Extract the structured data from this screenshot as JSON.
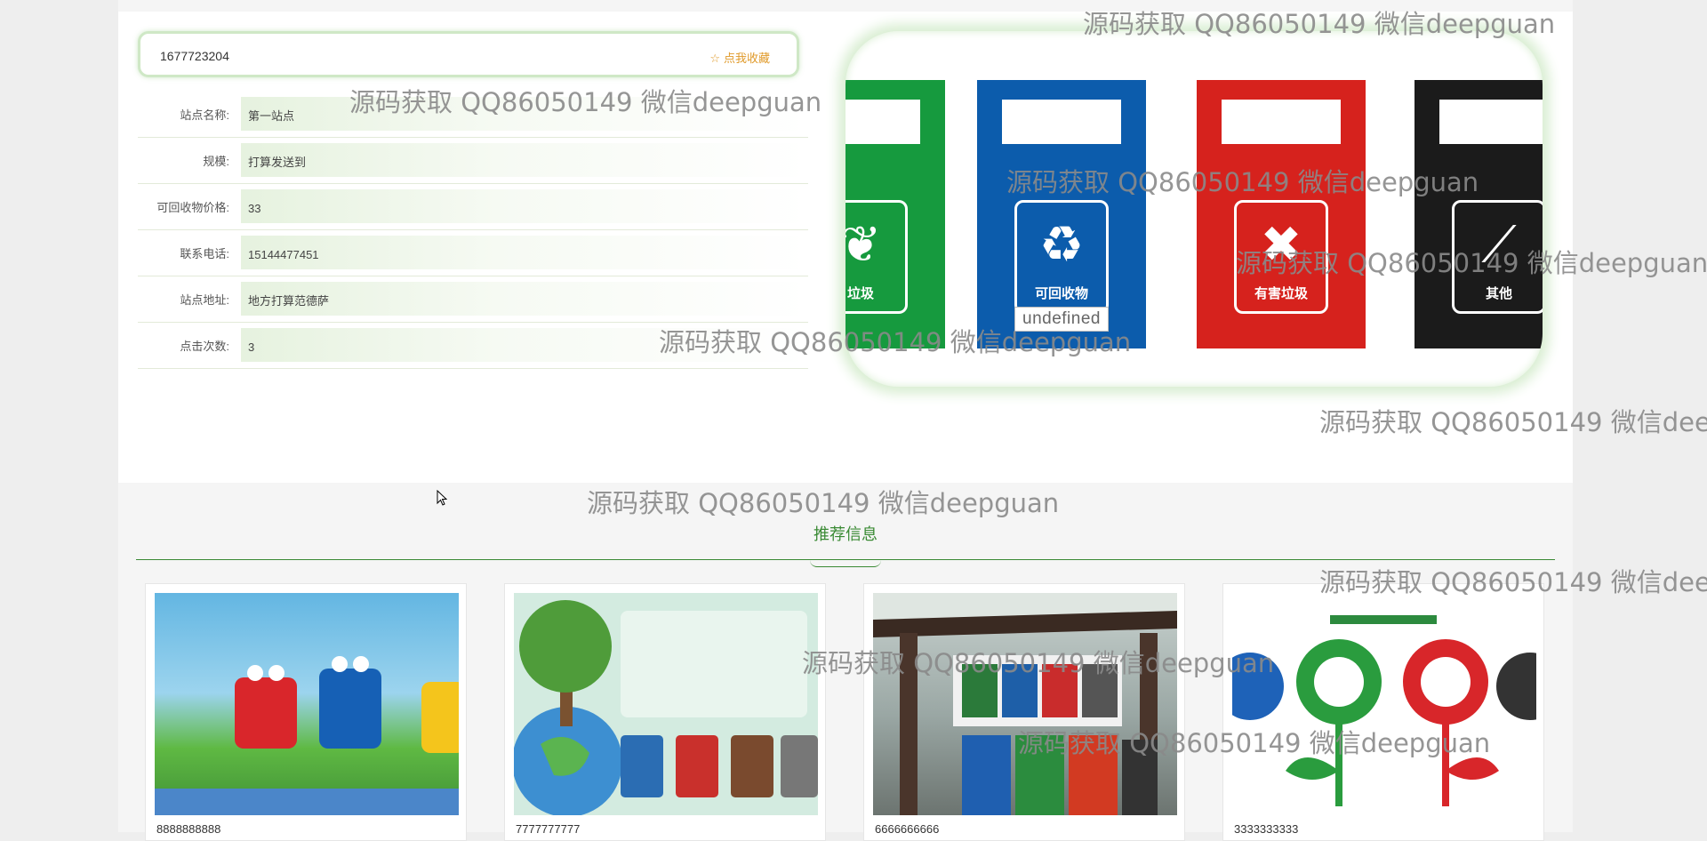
{
  "detail": {
    "id": "1677723204",
    "favorite_label": "点我收藏",
    "rows": [
      {
        "label": "站点名称:",
        "value": "第一站点"
      },
      {
        "label": "规模:",
        "value": "打算发送到"
      },
      {
        "label": "可回收物价格:",
        "value": "33"
      },
      {
        "label": "联系电话:",
        "value": "15144477451"
      },
      {
        "label": "站点地址:",
        "value": "地方打算范德萨"
      },
      {
        "label": "点击次数:",
        "value": "3"
      }
    ]
  },
  "banner": {
    "caption": "undefined",
    "bins": [
      {
        "label": "垃圾",
        "color": "#169a3e"
      },
      {
        "label": "可回收物",
        "color": "#0c5cac"
      },
      {
        "label": "有害垃圾",
        "color": "#d6221d"
      },
      {
        "label": "其他",
        "color": "#1b1b1b"
      }
    ]
  },
  "recommend": {
    "title": "推荐信息",
    "cards": [
      {
        "caption": "8888888888"
      },
      {
        "caption": "7777777777"
      },
      {
        "caption": "6666666666"
      },
      {
        "caption": "3333333333"
      }
    ]
  },
  "watermark": "源码获取 QQ86050149 微信deepguan",
  "colors": {
    "accent": "#3a8a34",
    "favorite": "#e09a2a"
  }
}
